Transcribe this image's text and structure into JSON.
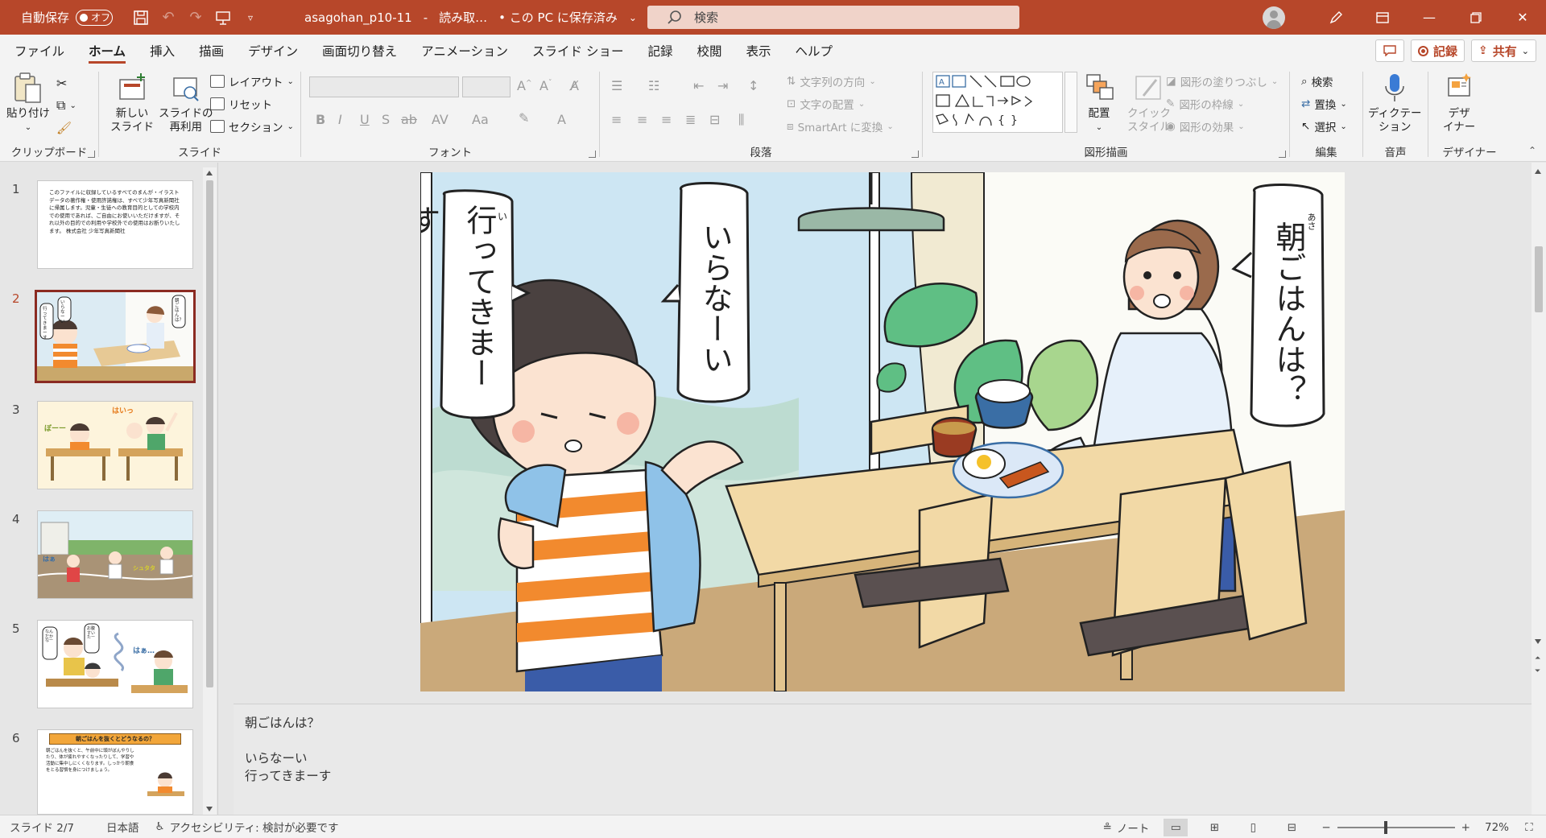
{
  "titlebar": {
    "autosave_label": "自動保存",
    "autosave_state": "オフ",
    "doc_name": "asagohan_p10-11",
    "doc_sep": "-",
    "doc_mode": "読み取…",
    "save_status": "• この PC に保存済み",
    "search_placeholder": "検索",
    "accent": "#b7472a"
  },
  "menu": {
    "tabs": [
      "ファイル",
      "ホーム",
      "挿入",
      "描画",
      "デザイン",
      "画面切り替え",
      "アニメーション",
      "スライド ショー",
      "記録",
      "校閲",
      "表示",
      "ヘルプ"
    ],
    "active": "ホーム",
    "record_label": "記録",
    "share_label": "共有"
  },
  "ribbon": {
    "clipboard": {
      "paste": "貼り付け",
      "label": "クリップボード"
    },
    "slides": {
      "new_slide_1": "新しい",
      "new_slide_2": "スライド",
      "reuse_1": "スライドの",
      "reuse_2": "再利用",
      "layout": "レイアウト",
      "reset": "リセット",
      "section": "セクション",
      "label": "スライド"
    },
    "font": {
      "label": "フォント"
    },
    "paragraph": {
      "text_direction": "文字列の方向",
      "align_text": "文字の配置",
      "smartart": "SmartArt に変換",
      "label": "段落"
    },
    "drawing": {
      "arrange": "配置",
      "quick_style_1": "クイック",
      "quick_style_2": "スタイル",
      "fill": "図形の塗りつぶし",
      "outline": "図形の枠線",
      "effects": "図形の効果",
      "label": "図形描画"
    },
    "editing": {
      "find": "検索",
      "replace": "置換",
      "select": "選択",
      "label": "編集"
    },
    "voice": {
      "dictate_1": "ディクテー",
      "dictate_2": "ション",
      "label": "音声"
    },
    "designer": {
      "ideas_1": "デザ",
      "ideas_2": "イナー",
      "label": "デザイナー"
    }
  },
  "thumbnails": [
    {
      "num": "1",
      "text": "このファイルに収録しているすべてのまんが・イラストデータの著作権・使用許諾権は、すべて少年写真新聞社に帰属します。児童・生徒への教育目的としての学校内での使用であれば、ご自由にお使いいただけますが、それ以外の目的での利用や学校外での使用はお断りいたします。 株式会社 少年写真新聞社"
    },
    {
      "num": "2",
      "active": true
    },
    {
      "num": "3"
    },
    {
      "num": "4"
    },
    {
      "num": "5"
    },
    {
      "num": "6",
      "title": "朝ごはんを抜くとどうなるの？",
      "text": "朝ごはんを抜くと、午前中に頭がぼんやりしたり、体が疲れやすくなったりして、学習や活動に集中しにくくなります。しっかり朝食をとる習慣を身につけましょう。"
    }
  ],
  "slide": {
    "mother_speech": "朝ごはんは？",
    "mother_ruby": "あさ",
    "boy_speech_1": "いらなーい",
    "boy_speech_2": "行ってきまーす",
    "boy_ruby": "い",
    "thumb2_mother": "朝ごはんは？",
    "thumb2_boy_1": "いらなーい",
    "thumb2_boy_2": "行ってきまーす",
    "thumb3_a": "ぼーー",
    "thumb3_b": "はいっ",
    "thumb4_a": "はぁ",
    "thumb4_b": "シュタタ",
    "thumb5_a": "なんだかなー",
    "thumb5_b": "お腹すいたー",
    "thumb5_c": "はぁ…"
  },
  "notes": {
    "lines": [
      "朝ごはんは？",
      "",
      "いらなーい",
      "行ってきまーす"
    ]
  },
  "statusbar": {
    "slide_info": "スライド 2/7",
    "language": "日本語",
    "accessibility": "アクセシビリティ: 検討が必要です",
    "notes_label": "ノート",
    "zoom": "72%"
  }
}
